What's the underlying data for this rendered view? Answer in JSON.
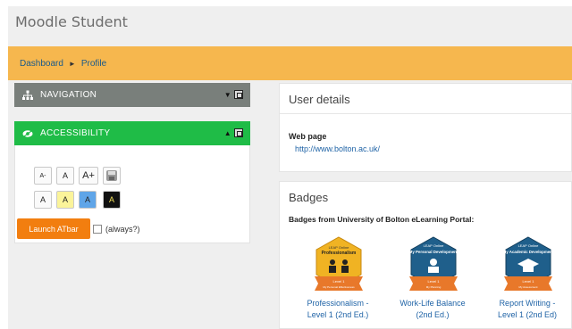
{
  "site": {
    "title": "Moodle Student"
  },
  "breadcrumb": {
    "items": [
      "Dashboard",
      "Profile"
    ],
    "separator": "►"
  },
  "navigation_block": {
    "title": "NAVIGATION"
  },
  "accessibility_block": {
    "title": "ACCESSIBILITY",
    "row1": [
      "A-",
      "A",
      "A+"
    ],
    "row2": [
      "A",
      "A",
      "A",
      "A"
    ],
    "launch_label": "Launch ATbar",
    "always_label": "(always?)"
  },
  "user_details": {
    "title": "User details",
    "web_page_label": "Web page",
    "web_page_url": "http://www.bolton.ac.uk/"
  },
  "badges": {
    "title": "Badges",
    "subtitle": "Badges from University of Bolton eLearning Portal:",
    "items": [
      {
        "label_line1": "Professionalism -",
        "label_line2": "Level 1 (2nd Ed.)",
        "top": "LEAP Online",
        "name": "Professionalism",
        "ribbon": "Level 1",
        "ribbon_sub": "My Personal Effectiveness",
        "color": "#f0b323"
      },
      {
        "label_line1": "Work-Life Balance",
        "label_line2": "(2nd Ed.)",
        "top": "LEAP Online",
        "name": "My Personal Development",
        "ribbon": "Level 1",
        "ribbon_sub": "My Planning",
        "color": "#1f5f8b"
      },
      {
        "label_line1": "Report Writing -",
        "label_line2": "Level 1 (2nd Ed)",
        "top": "LEAP Online",
        "name": "My Academic Development",
        "ribbon": "Level 1",
        "ribbon_sub": "My Assessment",
        "color": "#1f5f8b"
      }
    ]
  },
  "colors": {
    "accent_orange": "#f6b74e",
    "nav_grey": "#797f7b",
    "accessibility_green": "#1fbc47",
    "launch_orange": "#f27e0f",
    "link_blue": "#1f63a6"
  }
}
